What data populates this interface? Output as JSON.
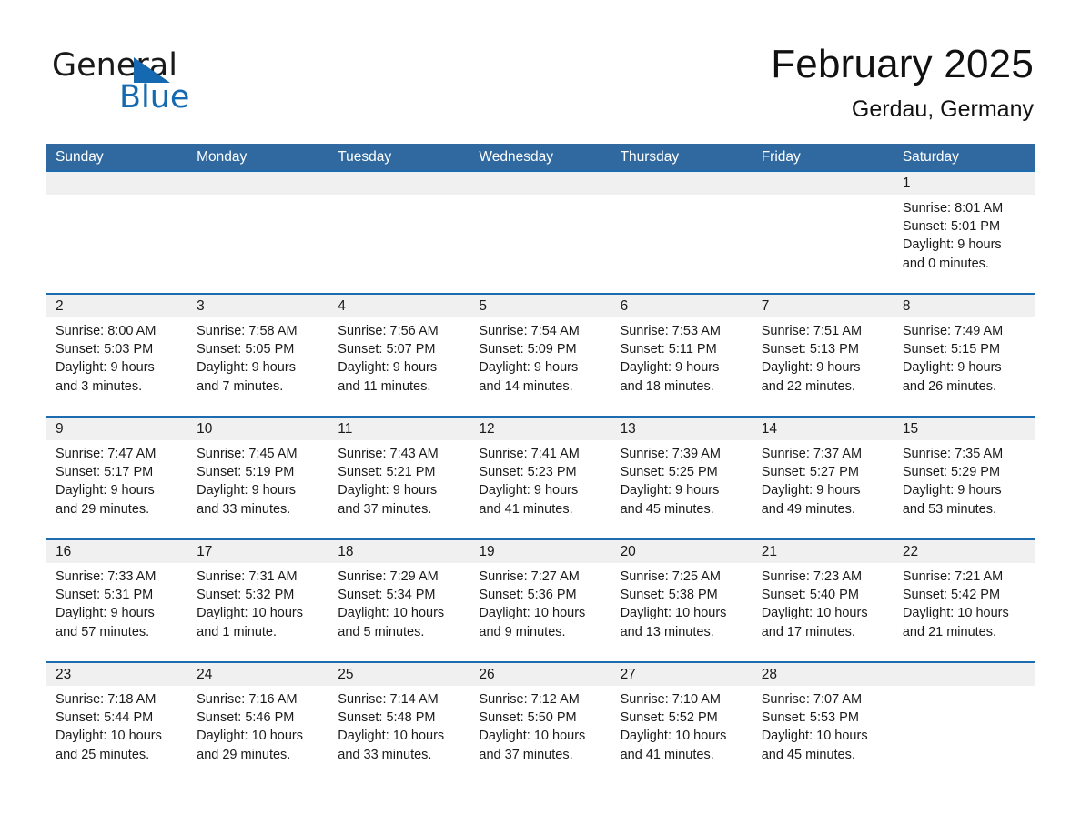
{
  "brand": {
    "name_part1": "General",
    "name_part2": "Blue",
    "triangle_color": "#1569b0",
    "text_color": "#1a1a1a"
  },
  "header": {
    "month_title": "February 2025",
    "location": "Gerdau, Germany"
  },
  "theme": {
    "header_row_bg": "#30699f",
    "header_row_text": "#ffffff",
    "row_divider": "#1d6cb0",
    "day_band_bg": "#f0f0f0",
    "page_bg": "#ffffff",
    "body_text": "#1a1a1a"
  },
  "weekdays": [
    "Sunday",
    "Monday",
    "Tuesday",
    "Wednesday",
    "Thursday",
    "Friday",
    "Saturday"
  ],
  "weeks": [
    [
      {
        "day": "",
        "empty": true,
        "sunrise": "",
        "sunset": "",
        "daylight_1": "",
        "daylight_2": ""
      },
      {
        "day": "",
        "empty": true,
        "sunrise": "",
        "sunset": "",
        "daylight_1": "",
        "daylight_2": ""
      },
      {
        "day": "",
        "empty": true,
        "sunrise": "",
        "sunset": "",
        "daylight_1": "",
        "daylight_2": ""
      },
      {
        "day": "",
        "empty": true,
        "sunrise": "",
        "sunset": "",
        "daylight_1": "",
        "daylight_2": ""
      },
      {
        "day": "",
        "empty": true,
        "sunrise": "",
        "sunset": "",
        "daylight_1": "",
        "daylight_2": ""
      },
      {
        "day": "",
        "empty": true,
        "sunrise": "",
        "sunset": "",
        "daylight_1": "",
        "daylight_2": ""
      },
      {
        "day": "1",
        "empty": false,
        "sunrise": "Sunrise: 8:01 AM",
        "sunset": "Sunset: 5:01 PM",
        "daylight_1": "Daylight: 9 hours",
        "daylight_2": "and 0 minutes."
      }
    ],
    [
      {
        "day": "2",
        "empty": false,
        "sunrise": "Sunrise: 8:00 AM",
        "sunset": "Sunset: 5:03 PM",
        "daylight_1": "Daylight: 9 hours",
        "daylight_2": "and 3 minutes."
      },
      {
        "day": "3",
        "empty": false,
        "sunrise": "Sunrise: 7:58 AM",
        "sunset": "Sunset: 5:05 PM",
        "daylight_1": "Daylight: 9 hours",
        "daylight_2": "and 7 minutes."
      },
      {
        "day": "4",
        "empty": false,
        "sunrise": "Sunrise: 7:56 AM",
        "sunset": "Sunset: 5:07 PM",
        "daylight_1": "Daylight: 9 hours",
        "daylight_2": "and 11 minutes."
      },
      {
        "day": "5",
        "empty": false,
        "sunrise": "Sunrise: 7:54 AM",
        "sunset": "Sunset: 5:09 PM",
        "daylight_1": "Daylight: 9 hours",
        "daylight_2": "and 14 minutes."
      },
      {
        "day": "6",
        "empty": false,
        "sunrise": "Sunrise: 7:53 AM",
        "sunset": "Sunset: 5:11 PM",
        "daylight_1": "Daylight: 9 hours",
        "daylight_2": "and 18 minutes."
      },
      {
        "day": "7",
        "empty": false,
        "sunrise": "Sunrise: 7:51 AM",
        "sunset": "Sunset: 5:13 PM",
        "daylight_1": "Daylight: 9 hours",
        "daylight_2": "and 22 minutes."
      },
      {
        "day": "8",
        "empty": false,
        "sunrise": "Sunrise: 7:49 AM",
        "sunset": "Sunset: 5:15 PM",
        "daylight_1": "Daylight: 9 hours",
        "daylight_2": "and 26 minutes."
      }
    ],
    [
      {
        "day": "9",
        "empty": false,
        "sunrise": "Sunrise: 7:47 AM",
        "sunset": "Sunset: 5:17 PM",
        "daylight_1": "Daylight: 9 hours",
        "daylight_2": "and 29 minutes."
      },
      {
        "day": "10",
        "empty": false,
        "sunrise": "Sunrise: 7:45 AM",
        "sunset": "Sunset: 5:19 PM",
        "daylight_1": "Daylight: 9 hours",
        "daylight_2": "and 33 minutes."
      },
      {
        "day": "11",
        "empty": false,
        "sunrise": "Sunrise: 7:43 AM",
        "sunset": "Sunset: 5:21 PM",
        "daylight_1": "Daylight: 9 hours",
        "daylight_2": "and 37 minutes."
      },
      {
        "day": "12",
        "empty": false,
        "sunrise": "Sunrise: 7:41 AM",
        "sunset": "Sunset: 5:23 PM",
        "daylight_1": "Daylight: 9 hours",
        "daylight_2": "and 41 minutes."
      },
      {
        "day": "13",
        "empty": false,
        "sunrise": "Sunrise: 7:39 AM",
        "sunset": "Sunset: 5:25 PM",
        "daylight_1": "Daylight: 9 hours",
        "daylight_2": "and 45 minutes."
      },
      {
        "day": "14",
        "empty": false,
        "sunrise": "Sunrise: 7:37 AM",
        "sunset": "Sunset: 5:27 PM",
        "daylight_1": "Daylight: 9 hours",
        "daylight_2": "and 49 minutes."
      },
      {
        "day": "15",
        "empty": false,
        "sunrise": "Sunrise: 7:35 AM",
        "sunset": "Sunset: 5:29 PM",
        "daylight_1": "Daylight: 9 hours",
        "daylight_2": "and 53 minutes."
      }
    ],
    [
      {
        "day": "16",
        "empty": false,
        "sunrise": "Sunrise: 7:33 AM",
        "sunset": "Sunset: 5:31 PM",
        "daylight_1": "Daylight: 9 hours",
        "daylight_2": "and 57 minutes."
      },
      {
        "day": "17",
        "empty": false,
        "sunrise": "Sunrise: 7:31 AM",
        "sunset": "Sunset: 5:32 PM",
        "daylight_1": "Daylight: 10 hours",
        "daylight_2": "and 1 minute."
      },
      {
        "day": "18",
        "empty": false,
        "sunrise": "Sunrise: 7:29 AM",
        "sunset": "Sunset: 5:34 PM",
        "daylight_1": "Daylight: 10 hours",
        "daylight_2": "and 5 minutes."
      },
      {
        "day": "19",
        "empty": false,
        "sunrise": "Sunrise: 7:27 AM",
        "sunset": "Sunset: 5:36 PM",
        "daylight_1": "Daylight: 10 hours",
        "daylight_2": "and 9 minutes."
      },
      {
        "day": "20",
        "empty": false,
        "sunrise": "Sunrise: 7:25 AM",
        "sunset": "Sunset: 5:38 PM",
        "daylight_1": "Daylight: 10 hours",
        "daylight_2": "and 13 minutes."
      },
      {
        "day": "21",
        "empty": false,
        "sunrise": "Sunrise: 7:23 AM",
        "sunset": "Sunset: 5:40 PM",
        "daylight_1": "Daylight: 10 hours",
        "daylight_2": "and 17 minutes."
      },
      {
        "day": "22",
        "empty": false,
        "sunrise": "Sunrise: 7:21 AM",
        "sunset": "Sunset: 5:42 PM",
        "daylight_1": "Daylight: 10 hours",
        "daylight_2": "and 21 minutes."
      }
    ],
    [
      {
        "day": "23",
        "empty": false,
        "sunrise": "Sunrise: 7:18 AM",
        "sunset": "Sunset: 5:44 PM",
        "daylight_1": "Daylight: 10 hours",
        "daylight_2": "and 25 minutes."
      },
      {
        "day": "24",
        "empty": false,
        "sunrise": "Sunrise: 7:16 AM",
        "sunset": "Sunset: 5:46 PM",
        "daylight_1": "Daylight: 10 hours",
        "daylight_2": "and 29 minutes."
      },
      {
        "day": "25",
        "empty": false,
        "sunrise": "Sunrise: 7:14 AM",
        "sunset": "Sunset: 5:48 PM",
        "daylight_1": "Daylight: 10 hours",
        "daylight_2": "and 33 minutes."
      },
      {
        "day": "26",
        "empty": false,
        "sunrise": "Sunrise: 7:12 AM",
        "sunset": "Sunset: 5:50 PM",
        "daylight_1": "Daylight: 10 hours",
        "daylight_2": "and 37 minutes."
      },
      {
        "day": "27",
        "empty": false,
        "sunrise": "Sunrise: 7:10 AM",
        "sunset": "Sunset: 5:52 PM",
        "daylight_1": "Daylight: 10 hours",
        "daylight_2": "and 41 minutes."
      },
      {
        "day": "28",
        "empty": false,
        "sunrise": "Sunrise: 7:07 AM",
        "sunset": "Sunset: 5:53 PM",
        "daylight_1": "Daylight: 10 hours",
        "daylight_2": "and 45 minutes."
      },
      {
        "day": "",
        "empty": true,
        "sunrise": "",
        "sunset": "",
        "daylight_1": "",
        "daylight_2": ""
      }
    ]
  ]
}
